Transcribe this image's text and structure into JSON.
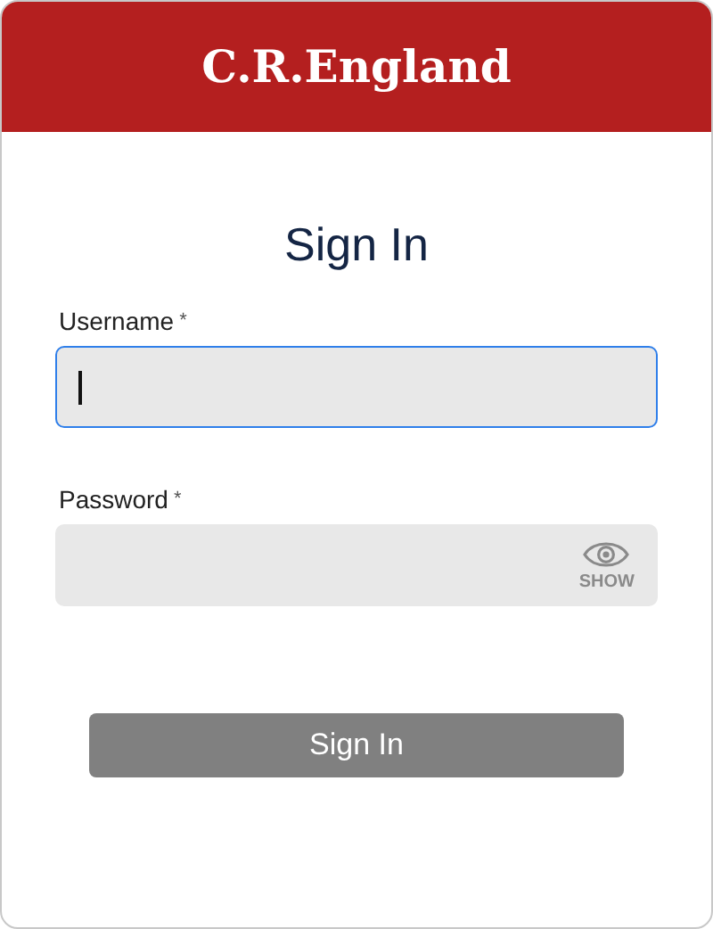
{
  "header": {
    "logo": "C.R.England"
  },
  "title": "Sign In",
  "fields": [
    {
      "kind": "text",
      "label": "Username",
      "required_mark": "*",
      "focused": true
    },
    {
      "kind": "password",
      "label": "Password",
      "required_mark": "*",
      "focused": false,
      "toggle": "SHOW"
    }
  ],
  "button": {
    "label": "Sign In",
    "disabled": true
  }
}
